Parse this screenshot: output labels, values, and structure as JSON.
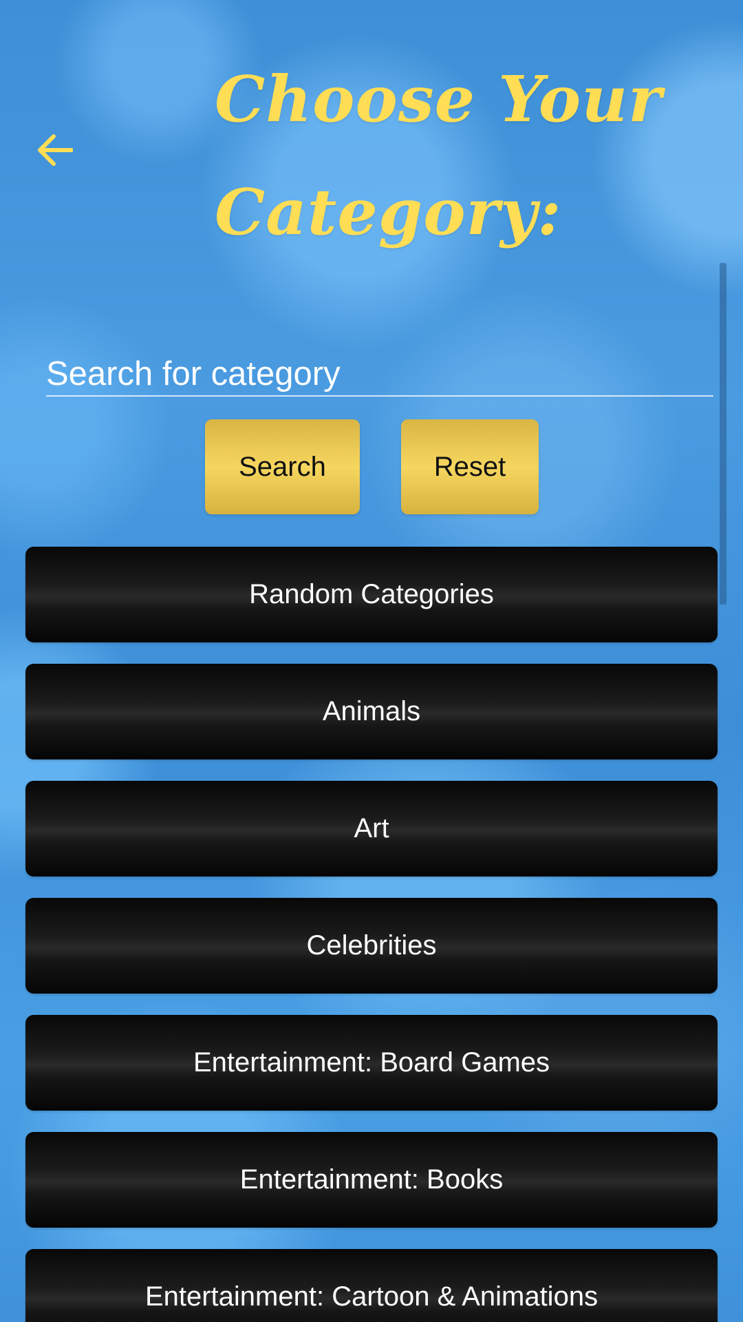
{
  "header": {
    "title_line1": "Choose Your",
    "title_line2": "Category:",
    "back_icon": "arrow-left-icon"
  },
  "search": {
    "placeholder": "Search for category",
    "value": "",
    "search_label": "Search",
    "reset_label": "Reset"
  },
  "categories": [
    {
      "label": "Random Categories"
    },
    {
      "label": "Animals"
    },
    {
      "label": "Art"
    },
    {
      "label": "Celebrities"
    },
    {
      "label": "Entertainment: Board Games"
    },
    {
      "label": "Entertainment: Books"
    },
    {
      "label": "Entertainment: Cartoon & Animations"
    }
  ],
  "colors": {
    "accent_yellow": "#ffdd55",
    "button_gold": "#f6d65f",
    "category_black": "#1b1b1b",
    "background_blue": "#3f8fd8"
  }
}
